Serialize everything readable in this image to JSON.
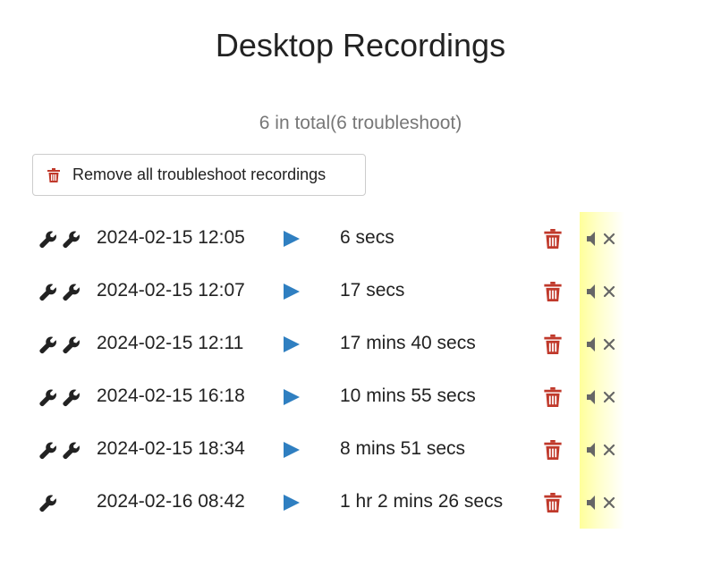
{
  "page": {
    "title": "Desktop Recordings",
    "summary": "6 in total(6 troubleshoot)"
  },
  "remove_all_button": {
    "label": "Remove all troubleshoot recordings",
    "icon": "trash-icon"
  },
  "colors": {
    "play": "#2f7fc1",
    "trash": "#c0392b",
    "highlight": "#ffff9a",
    "muted_text": "#777777"
  },
  "recordings": [
    {
      "wrench_count": 2,
      "date": "2024-02-15 12:05",
      "duration": "6 secs"
    },
    {
      "wrench_count": 2,
      "date": "2024-02-15 12:07",
      "duration": "17 secs"
    },
    {
      "wrench_count": 2,
      "date": "2024-02-15 12:11",
      "duration": "17 mins 40 secs"
    },
    {
      "wrench_count": 2,
      "date": "2024-02-15 16:18",
      "duration": "10 mins 55 secs"
    },
    {
      "wrench_count": 2,
      "date": "2024-02-15 18:34",
      "duration": "8 mins 51 secs"
    },
    {
      "wrench_count": 1,
      "date": "2024-02-16 08:42",
      "duration": "1 hr 2 mins 26 secs"
    }
  ]
}
